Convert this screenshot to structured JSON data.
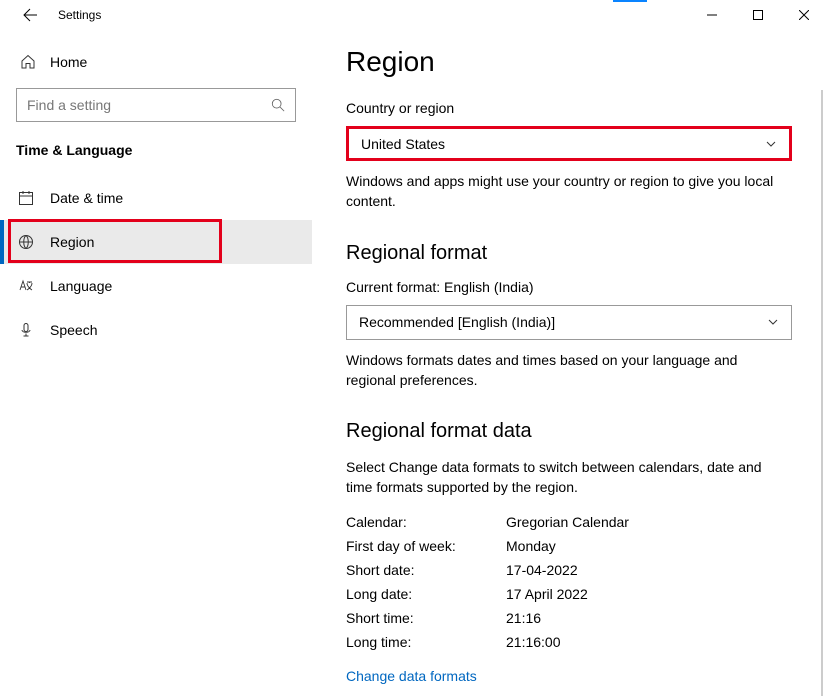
{
  "titlebar": {
    "app_name": "Settings"
  },
  "sidebar": {
    "home_label": "Home",
    "search_placeholder": "Find a setting",
    "category_title": "Time & Language",
    "items": [
      {
        "label": "Date & time"
      },
      {
        "label": "Region"
      },
      {
        "label": "Language"
      },
      {
        "label": "Speech"
      }
    ]
  },
  "main": {
    "page_title": "Region",
    "country_label": "Country or region",
    "country_value": "United States",
    "country_desc": "Windows and apps might use your country or region to give you local content.",
    "format_heading": "Regional format",
    "current_format_label": "Current format: English (India)",
    "format_value": "Recommended [English (India)]",
    "format_desc": "Windows formats dates and times based on your language and regional preferences.",
    "data_heading": "Regional format data",
    "data_desc": "Select Change data formats to switch between calendars, date and time formats supported by the region.",
    "rows": {
      "calendar_k": "Calendar:",
      "calendar_v": "Gregorian Calendar",
      "fdow_k": "First day of week:",
      "fdow_v": "Monday",
      "sdate_k": "Short date:",
      "sdate_v": "17-04-2022",
      "ldate_k": "Long date:",
      "ldate_v": "17 April 2022",
      "stime_k": "Short time:",
      "stime_v": "21:16",
      "ltime_k": "Long time:",
      "ltime_v": "21:16:00"
    },
    "change_link": "Change data formats"
  }
}
